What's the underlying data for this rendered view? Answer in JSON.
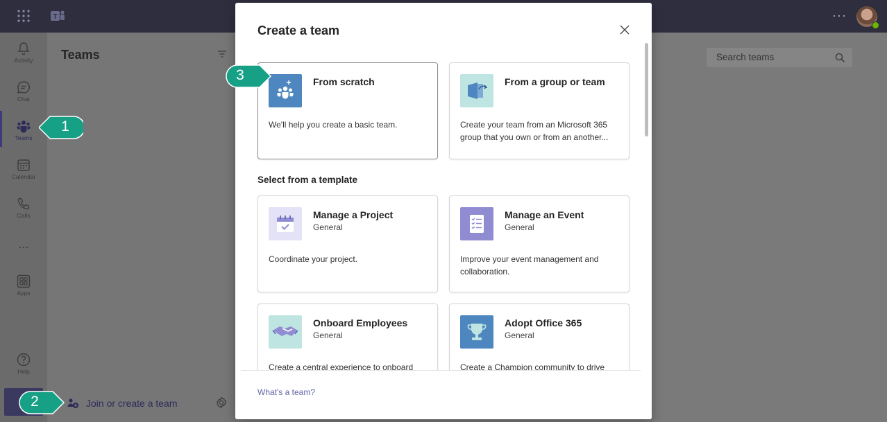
{
  "rail": {
    "items": [
      {
        "label": "Activity"
      },
      {
        "label": "Chat"
      },
      {
        "label": "Teams"
      },
      {
        "label": "Calendar"
      },
      {
        "label": "Calls"
      },
      {
        "label": "..."
      },
      {
        "label": "Apps"
      },
      {
        "label": "Help"
      }
    ]
  },
  "panel": {
    "title": "Teams",
    "join_label": "Join or create a team"
  },
  "search": {
    "placeholder": "Search teams"
  },
  "modal": {
    "title": "Create a team",
    "from_scratch": {
      "name": "From scratch",
      "desc": "We'll help you create a basic team."
    },
    "from_group": {
      "name": "From a group or team",
      "desc": "Create your team from an Microsoft 365 group that you own or from an another..."
    },
    "template_heading": "Select from a template",
    "templates": [
      {
        "name": "Manage a Project",
        "sub": "General",
        "desc": "Coordinate your project.",
        "icon": "calendar-check-icon",
        "color": "#e4e2f7"
      },
      {
        "name": "Manage an Event",
        "sub": "General",
        "desc": "Improve your event management and collaboration.",
        "icon": "checklist-icon",
        "color": "#8f8cd1"
      },
      {
        "name": "Onboard Employees",
        "sub": "General",
        "desc": "Create a central experience to onboard",
        "icon": "handshake-icon",
        "color": "#bfe5e3"
      },
      {
        "name": "Adopt Office 365",
        "sub": "General",
        "desc": "Create a Champion community to drive",
        "icon": "trophy-icon",
        "color": "#4e87c0"
      }
    ],
    "footer_link": "What's a team?"
  },
  "callouts": [
    {
      "num": "1"
    },
    {
      "num": "2"
    },
    {
      "num": "3"
    }
  ],
  "colors": {
    "accent": "#6264a7",
    "callout": "#16a085",
    "topbar": "#2e2e3f"
  }
}
